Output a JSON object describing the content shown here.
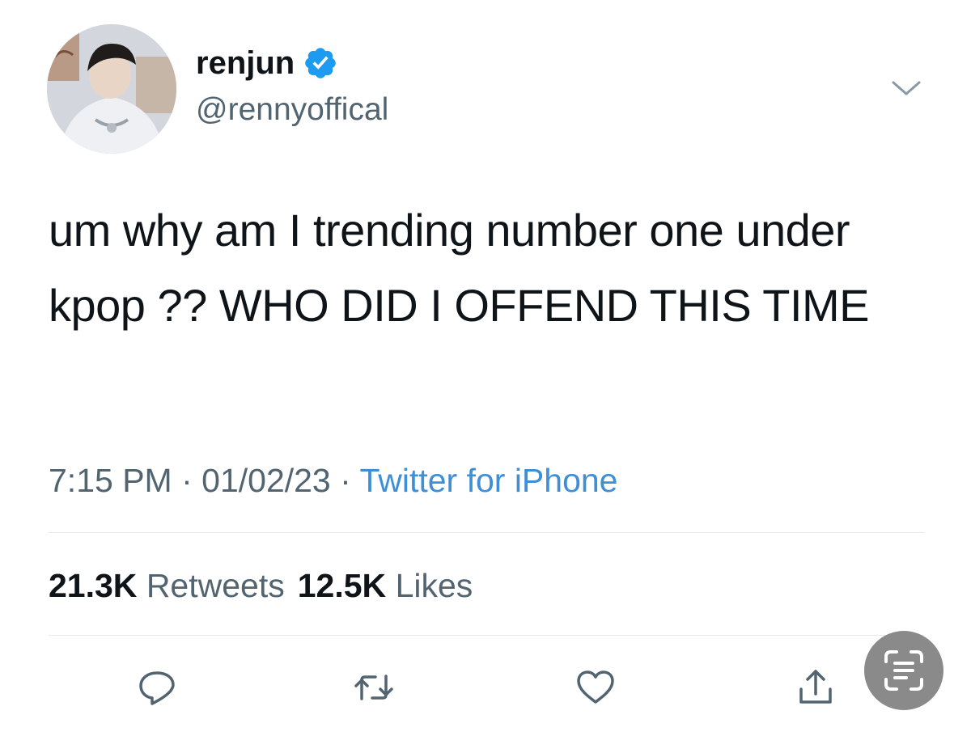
{
  "author": {
    "display_name": "renjun",
    "handle": "@rennyoffical",
    "verified": true,
    "verified_color": "#1d9bf0"
  },
  "tweet": {
    "text": "um why am I trending number one under kpop ?? WHO DID I OFFEND THIS TIME",
    "time": "7:15 PM",
    "date": "01/02/23",
    "separator": " · ",
    "source": "Twitter for iPhone"
  },
  "stats": {
    "retweets_count": "21.3K",
    "retweets_label": "Retweets",
    "likes_count": "12.5K",
    "likes_label": "Likes"
  },
  "actions": [
    "reply-icon",
    "retweet-icon",
    "like-icon",
    "share-icon"
  ],
  "overlay": {
    "icon": "live-text-icon",
    "color": "#8a8a8a"
  },
  "colors": {
    "text": "#0f1419",
    "secondary": "#536471",
    "link": "#3f8fd6",
    "divider": "#e6e8ea"
  }
}
